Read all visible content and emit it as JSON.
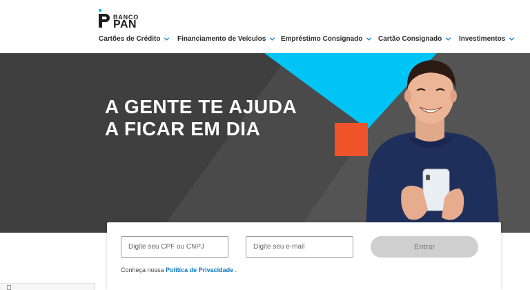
{
  "brand": {
    "name_small": "BANCO",
    "name_big": "PAN",
    "accent_cyan": "#00C4F5",
    "accent_orange": "#F0522A",
    "hero_bg": "#4A4A4A",
    "link_blue": "#0A78C2"
  },
  "nav": {
    "items": [
      {
        "label": "Cartões de Crédito",
        "icon": "chevron-down-icon"
      },
      {
        "label": "Financiamento de Veículos",
        "icon": "chevron-down-icon"
      },
      {
        "label": "Empréstimo Consignado",
        "icon": "chevron-down-icon"
      },
      {
        "label": "Cartão Consignado",
        "icon": "chevron-down-icon"
      },
      {
        "label": "Investimentos",
        "icon": "chevron-down-icon"
      }
    ]
  },
  "hero": {
    "title_line1": "A GENTE TE AJUDA",
    "title_line2": "A FICAR EM DIA"
  },
  "form": {
    "cpf_placeholder": "Digite seu CPF ou CNPJ",
    "email_placeholder": "Digite seu e-mail",
    "submit_label": "Entrar",
    "privacy_prefix": "Conheça nossa",
    "privacy_link": "Política de Privacidade",
    "privacy_suffix": "."
  }
}
